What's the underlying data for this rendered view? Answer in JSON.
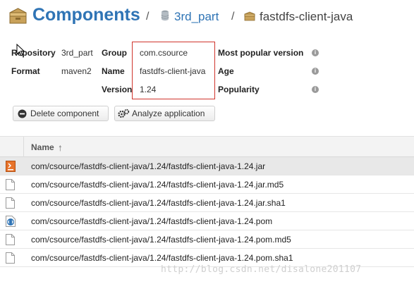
{
  "header": {
    "title": "Components",
    "separator": "/",
    "crumbs": [
      {
        "label": "3rd_part",
        "icon": "database-icon"
      },
      {
        "label": "fastdfs-client-java",
        "icon": "component-box-icon"
      }
    ]
  },
  "info": {
    "repository_label": "Repository",
    "repository_value": "3rd_part",
    "format_label": "Format",
    "format_value": "maven2",
    "group_label": "Group",
    "group_value": "com.csource",
    "name_label": "Name",
    "name_value": "fastdfs-client-java",
    "version_label": "Version",
    "version_value": "1.24",
    "popular_label": "Most popular version",
    "age_label": "Age",
    "popularity_label": "Popularity"
  },
  "buttons": {
    "delete_label": "Delete component",
    "analyze_label": "Analyze application"
  },
  "table": {
    "column_name": "Name",
    "rows": [
      {
        "path": "com/csource/fastdfs-client-java/1.24/fastdfs-client-java-1.24.jar",
        "icon": "jar-file-icon"
      },
      {
        "path": "com/csource/fastdfs-client-java/1.24/fastdfs-client-java-1.24.jar.md5",
        "icon": "file-icon"
      },
      {
        "path": "com/csource/fastdfs-client-java/1.24/fastdfs-client-java-1.24.jar.sha1",
        "icon": "file-icon"
      },
      {
        "path": "com/csource/fastdfs-client-java/1.24/fastdfs-client-java-1.24.pom",
        "icon": "xml-file-icon"
      },
      {
        "path": "com/csource/fastdfs-client-java/1.24/fastdfs-client-java-1.24.pom.md5",
        "icon": "file-icon"
      },
      {
        "path": "com/csource/fastdfs-client-java/1.24/fastdfs-client-java-1.24.pom.sha1",
        "icon": "file-icon"
      }
    ]
  },
  "watermark": "http://blog.csdn.net/disalone201107",
  "colors": {
    "accent": "#2f74b5",
    "highlight_box": "#d0342c",
    "selected_row": "#e8e8e8"
  }
}
